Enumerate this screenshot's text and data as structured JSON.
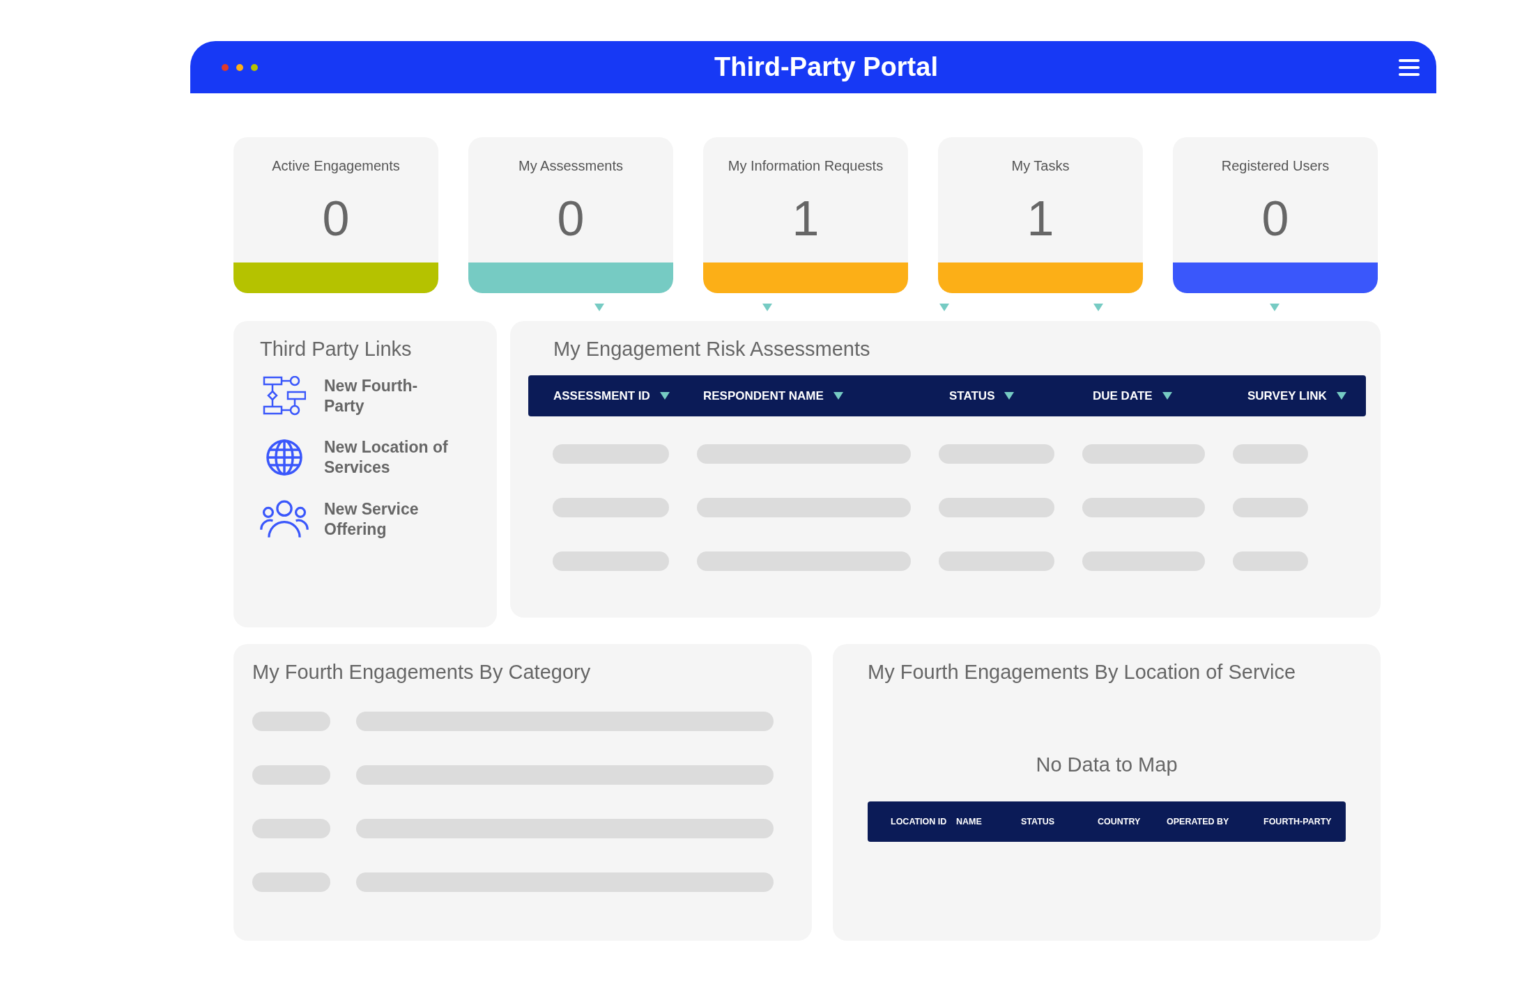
{
  "window": {
    "title": "Third-Party Portal"
  },
  "stats": [
    {
      "label": "Active Engagements",
      "value": "0",
      "color": "#b5c200"
    },
    {
      "label": "My Assessments",
      "value": "0",
      "color": "#76cbc3"
    },
    {
      "label": "My Information Requests",
      "value": "1",
      "color": "#fcaf17"
    },
    {
      "label": "My Tasks",
      "value": "1",
      "color": "#fcaf17"
    },
    {
      "label": "Registered Users",
      "value": "0",
      "color": "#3a57fb"
    }
  ],
  "links": {
    "title": "Third Party Links",
    "items": [
      {
        "kind": "flow",
        "label": "New Fourth-Party"
      },
      {
        "kind": "globe",
        "label": "New Location of Services"
      },
      {
        "kind": "people",
        "label": "New Service Offering"
      }
    ]
  },
  "assessments": {
    "title": "My Engagement Risk Assessments",
    "columns": [
      "ASSESSMENT ID",
      "RESPONDENT NAME",
      "STATUS",
      "DUE DATE",
      "SURVEY LINK"
    ]
  },
  "by_category": {
    "title": "My Fourth Engagements By Category"
  },
  "by_location": {
    "title": "My Fourth Engagements By Location of Service",
    "message": "No Data to Map",
    "columns": [
      "LOCATION ID",
      "NAME",
      "STATUS",
      "COUNTRY",
      "OPERATED BY",
      "FOURTH-PARTY"
    ]
  }
}
